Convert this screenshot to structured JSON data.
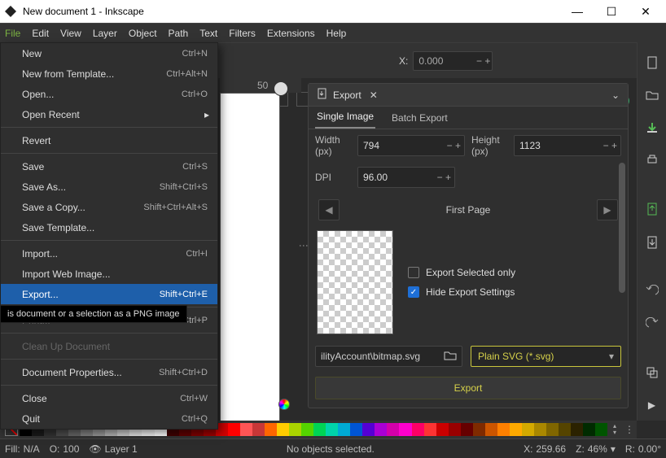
{
  "window": {
    "title": "New document 1 - Inkscape"
  },
  "menubar": [
    "File",
    "Edit",
    "View",
    "Layer",
    "Object",
    "Path",
    "Text",
    "Filters",
    "Extensions",
    "Help"
  ],
  "file_menu": [
    {
      "label": "New",
      "accel": "Ctrl+N"
    },
    {
      "label": "New from Template...",
      "accel": "Ctrl+Alt+N"
    },
    {
      "label": "Open...",
      "accel": "Ctrl+O"
    },
    {
      "label": "Open Recent",
      "accel": "",
      "submenu": true
    },
    {
      "sep": true
    },
    {
      "label": "Revert",
      "accel": ""
    },
    {
      "sep": true
    },
    {
      "label": "Save",
      "accel": "Ctrl+S"
    },
    {
      "label": "Save As...",
      "accel": "Shift+Ctrl+S"
    },
    {
      "label": "Save a Copy...",
      "accel": "Shift+Ctrl+Alt+S"
    },
    {
      "label": "Save Template...",
      "accel": ""
    },
    {
      "sep": true
    },
    {
      "label": "Import...",
      "accel": "Ctrl+I"
    },
    {
      "label": "Import Web Image...",
      "accel": ""
    },
    {
      "label": "Export...",
      "accel": "Shift+Ctrl+E",
      "hl": true
    },
    {
      "sep": true
    },
    {
      "label": "Print...",
      "accel": "Ctrl+P",
      "dis": true
    },
    {
      "sep": true
    },
    {
      "label": "Clean Up Document",
      "accel": "",
      "dis": true
    },
    {
      "sep": true
    },
    {
      "label": "Document Properties...",
      "accel": "Shift+Ctrl+D"
    },
    {
      "sep": true
    },
    {
      "label": "Close",
      "accel": "Ctrl+W"
    },
    {
      "label": "Quit",
      "accel": "Ctrl+Q"
    }
  ],
  "tooltip": "is document or a selection as a PNG image",
  "ruler_mark": "50",
  "coord": {
    "x_label": "X:",
    "x_value": "0.000"
  },
  "export": {
    "title": "Export",
    "tabs": {
      "single": "Single Image",
      "batch": "Batch Export"
    },
    "width_label": "Width (px)",
    "width_value": "794",
    "height_label": "Height (px)",
    "height_value": "1123",
    "dpi_label": "DPI",
    "dpi_value": "96.00",
    "page_nav": "First Page",
    "opt_selected": "Export Selected only",
    "opt_hide": "Hide Export Settings",
    "path": "ilityAccount\\bitmap.svg",
    "format": "Plain SVG (*.svg)",
    "button": "Export"
  },
  "palette": [
    "#000000",
    "#1a1a1a",
    "#333333",
    "#4d4d4d",
    "#666666",
    "#808080",
    "#999999",
    "#b3b3b3",
    "#cccccc",
    "#e6e6e6",
    "#f2f2f2",
    "#ffffff",
    "#400000",
    "#600000",
    "#800000",
    "#a00000",
    "#d40000",
    "#ff0000",
    "#ff5555",
    "#c83737",
    "#ff6600",
    "#ffcc00",
    "#aad400",
    "#55d400",
    "#00d455",
    "#00d4aa",
    "#00aad4",
    "#0055d4",
    "#5500d4",
    "#aa00d4",
    "#d400aa",
    "#ff00cc",
    "#ff0066",
    "#ff3333",
    "#cc0000",
    "#990000",
    "#660000",
    "#7f2a00",
    "#cc5500",
    "#ff8000",
    "#ffaa00",
    "#d4aa00",
    "#aa8800",
    "#806600",
    "#554400",
    "#2b2200",
    "#002b00",
    "#005500"
  ],
  "status": {
    "fill_label": "Fill:",
    "fill_value": "N/A",
    "opacity_label": "O:",
    "opacity_value": "100",
    "layer": "Layer 1",
    "message": "No objects selected.",
    "x_label": "X:",
    "x_value": "259.66",
    "z_label": "Z:",
    "z_value": "46%",
    "r_label": "R:",
    "r_value": "0.00°"
  }
}
